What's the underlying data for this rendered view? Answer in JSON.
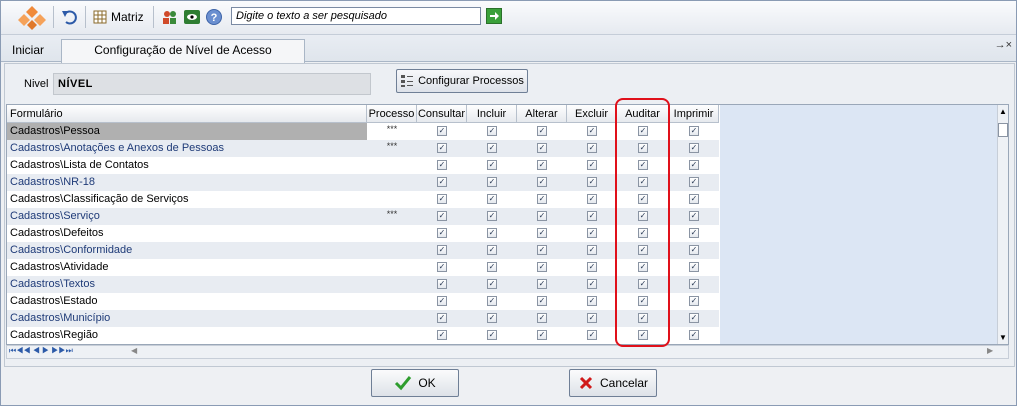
{
  "toolbar": {
    "matriz_label": "Matriz",
    "search_placeholder": "Digite o texto a ser pesquisado"
  },
  "start": {
    "label": "Iniciar"
  },
  "tab": {
    "label": "Configuração de Nível de Acesso",
    "icons": "→×"
  },
  "nivel": {
    "label": "Nivel",
    "value": "NÍVEL"
  },
  "configure_button": {
    "label": "Configurar Processos"
  },
  "grid": {
    "columns": [
      "Formulário",
      "Processo",
      "Consultar",
      "Incluir",
      "Alterar",
      "Excluir",
      "Auditar",
      "Imprimir"
    ],
    "rows": [
      {
        "form": "Cadastros\\Pessoa",
        "processo": "***"
      },
      {
        "form": "Cadastros\\Anotações e Anexos de Pessoas",
        "processo": "***"
      },
      {
        "form": "Cadastros\\Lista de Contatos",
        "processo": ""
      },
      {
        "form": "Cadastros\\NR-18",
        "processo": ""
      },
      {
        "form": "Cadastros\\Classificação de Serviços",
        "processo": ""
      },
      {
        "form": "Cadastros\\Serviço",
        "processo": "***"
      },
      {
        "form": "Cadastros\\Defeitos",
        "processo": ""
      },
      {
        "form": "Cadastros\\Conformidade",
        "processo": ""
      },
      {
        "form": "Cadastros\\Atividade",
        "processo": ""
      },
      {
        "form": "Cadastros\\Textos",
        "processo": ""
      },
      {
        "form": "Cadastros\\Estado",
        "processo": ""
      },
      {
        "form": "Cadastros\\Município",
        "processo": ""
      },
      {
        "form": "Cadastros\\Região",
        "processo": ""
      }
    ],
    "nav": "⏮◀◀ ◀ ▶ ▶▶⏭"
  },
  "buttons": {
    "ok": "OK",
    "cancel": "Cancelar"
  },
  "colors": {
    "row_alt": "#e8ecf2",
    "selected": "#b0b0b0",
    "highlight": "#e0101a"
  }
}
